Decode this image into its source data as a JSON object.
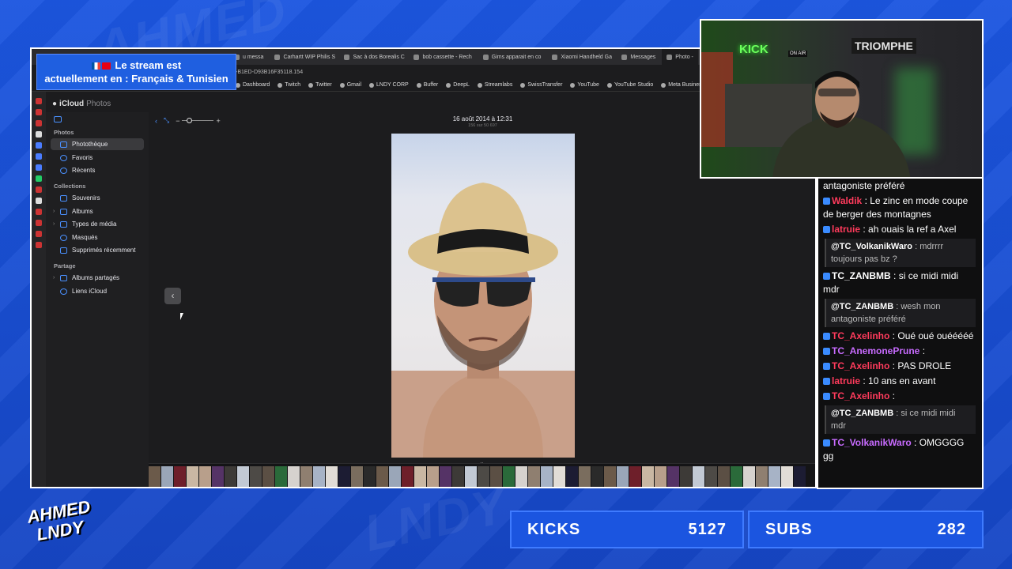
{
  "overlay": {
    "language_banner_line1": "Le stream est",
    "language_banner_line2": "actuellement en : Français & Tunisien",
    "logo_line1": "AHMED",
    "logo_line2": "LNDY",
    "kicks_label": "KICKS",
    "kicks_value": "5127",
    "subs_label": "SUBS",
    "subs_value": "282"
  },
  "browser": {
    "tabs": [
      {
        "label": "u messa"
      },
      {
        "label": "Carhartt WIP Philis S"
      },
      {
        "label": "Sac à dos Borealis C"
      },
      {
        "label": "bob cassette - Rech"
      },
      {
        "label": "Gims apparait en co"
      },
      {
        "label": "Xiaomi Handheld Ga"
      },
      {
        "label": "Messages"
      },
      {
        "label": "Photo -"
      }
    ],
    "url_fragment": "-B1ED-D93B16F35118.154",
    "bookmarks": [
      {
        "label": "Dashboard"
      },
      {
        "label": "Twitch"
      },
      {
        "label": "Twitter"
      },
      {
        "label": "Gmail"
      },
      {
        "label": "LNDY CORP"
      },
      {
        "label": "Buffer"
      },
      {
        "label": "DeepL"
      },
      {
        "label": "Streamlabs"
      },
      {
        "label": "SwissTransfer"
      },
      {
        "label": "YouTube"
      },
      {
        "label": "YouTube Studio"
      },
      {
        "label": "Meta Business Su"
      }
    ]
  },
  "icloud": {
    "brand": "iCloud",
    "app": "Photos",
    "sections": {
      "photos": "Photos",
      "collections": "Collections",
      "partage": "Partage"
    },
    "items": {
      "phototheque": "Photothèque",
      "favoris": "Favoris",
      "recents": "Récents",
      "souvenirs": "Souvenirs",
      "albums": "Albums",
      "types": "Types de média",
      "masques": "Masqués",
      "supprimes": "Supprimés récemment",
      "albums_partages": "Albums partagés",
      "liens": "Liens iCloud"
    },
    "photo_date": "16 août 2014 à 12:31",
    "photo_count": "156 sur 50 697",
    "zoom_minus": "−",
    "zoom_plus": "+"
  },
  "chat": {
    "messages": [
      {
        "type": "plain",
        "text": "antagoniste préféré"
      },
      {
        "type": "msg",
        "user": "Waldik",
        "color": "#ff3b5c",
        "text": "Le zinc en mode coupe de berger des montagnes"
      },
      {
        "type": "msg",
        "user": "latruie",
        "color": "#ff3b5c",
        "text": "ah ouais la ref a Axel"
      },
      {
        "type": "reply",
        "ruser": "@TC_VolkanikWaro",
        "rtext": "mdrrrr toujours pas bz ?"
      },
      {
        "type": "msg",
        "user": "TC_ZANBMB",
        "color": "#ffffff",
        "text": "si ce midi midi mdr"
      },
      {
        "type": "reply",
        "ruser": "@TC_ZANBMB",
        "rtext": "wesh mon antagoniste préféré"
      },
      {
        "type": "msg",
        "user": "TC_Axelinho",
        "color": "#ff3b5c",
        "text": "Oué oué ouééééé"
      },
      {
        "type": "msg",
        "user": "TC_AnemonePrune",
        "color": "#c86bff",
        "text": ""
      },
      {
        "type": "msg",
        "user": "TC_Axelinho",
        "color": "#ff3b5c",
        "text": "PAS DROLE"
      },
      {
        "type": "msg",
        "user": "latruie",
        "color": "#ff3b5c",
        "text": "10 ans en avant"
      },
      {
        "type": "msg",
        "user": "TC_Axelinho",
        "color": "#ff3b5c",
        "text": ""
      },
      {
        "type": "reply",
        "ruser": "@TC_ZANBMB",
        "rtext": "si ce midi midi mdr"
      },
      {
        "type": "msg",
        "user": "TC_VolkanikWaro",
        "color": "#c86bff",
        "text": "OMGGGG gg"
      }
    ]
  },
  "webcam": {
    "kick_sign": "KICK",
    "on_air": "ON AIR",
    "poster": "TRIOMPHE"
  }
}
